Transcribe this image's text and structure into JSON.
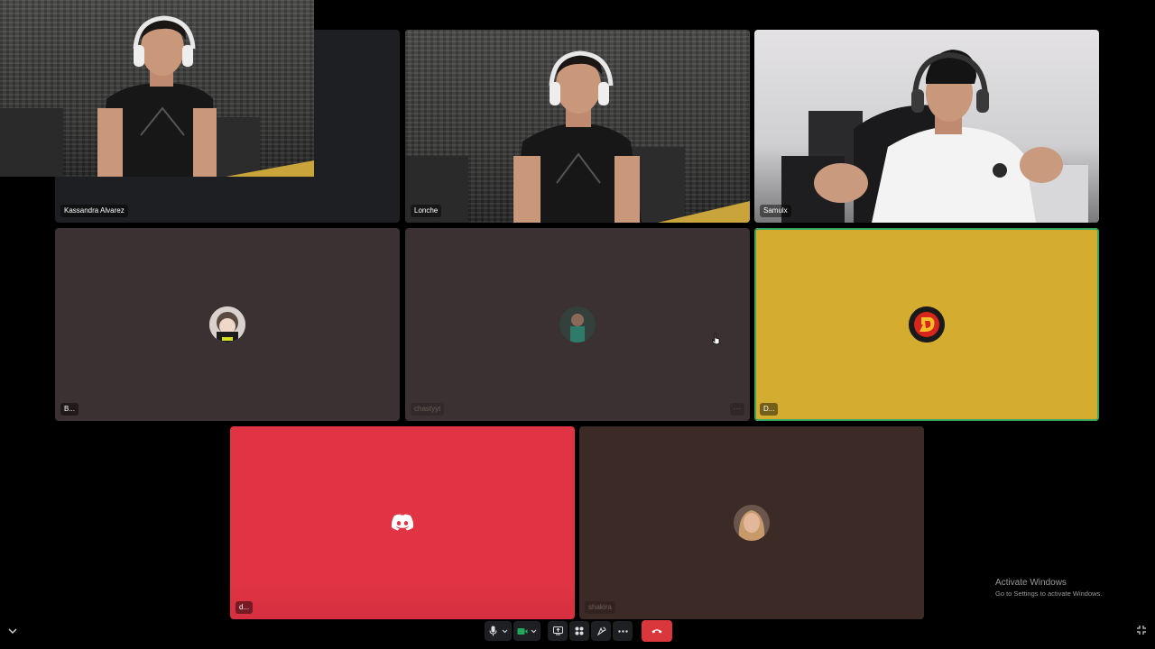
{
  "participants": {
    "kassandra": {
      "name": "Kassandra Alvarez"
    },
    "lonche": {
      "name": "Lonche"
    },
    "samulx": {
      "name": "Samulx"
    },
    "b": {
      "name": "B..."
    },
    "chastyyt": {
      "name": "chastyyt"
    },
    "d": {
      "name": "D..."
    },
    "dsm": {
      "name": "d..."
    },
    "shakira": {
      "name": "shakira"
    }
  },
  "tile_colors": {
    "b": "#3b3132",
    "chastyyt": "#3b3132",
    "d": "#d4ad30",
    "discord": "#e03444",
    "shakira": "#3c2a26"
  },
  "watermark": {
    "title": "Activate Windows",
    "subtitle": "Go to Settings to activate Windows."
  },
  "icons": {
    "mic": "microphone-icon",
    "camera": "camera-icon",
    "screen_share": "screen-share-icon",
    "activities": "activities-icon",
    "soundboard": "soundboard-icon",
    "more": "more-options-icon",
    "hangup": "hang-up-icon",
    "fullscreen": "fullscreen-icon",
    "chevron": "chevron-down-icon"
  },
  "more_label": "···"
}
